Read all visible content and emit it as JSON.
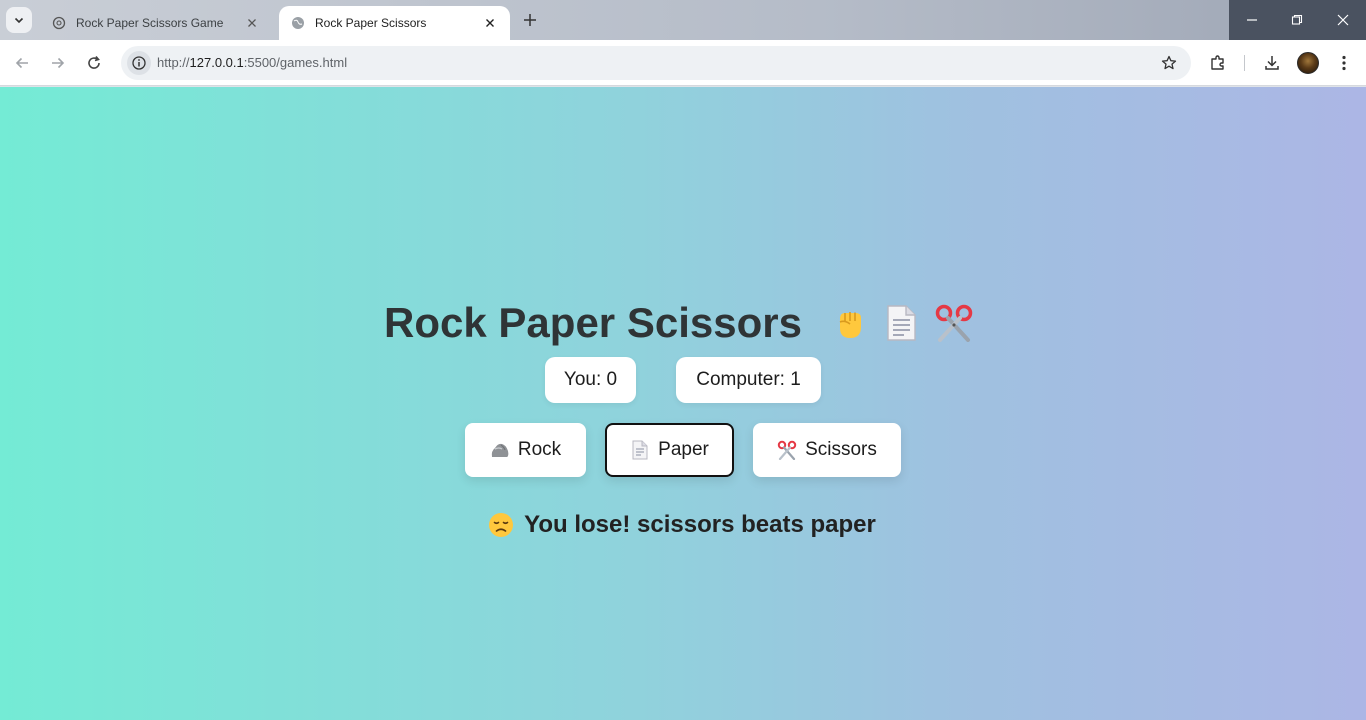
{
  "browser": {
    "tabs": [
      {
        "title": "Rock Paper Scissors Game",
        "active": false
      },
      {
        "title": "Rock Paper Scissors",
        "active": true
      }
    ],
    "url_prefix": "http://",
    "url_host": "127.0.0.1",
    "url_rest": ":5500/games.html"
  },
  "game": {
    "title": "Rock Paper Scissors",
    "title_icons": [
      "fist-icon",
      "page-icon",
      "scissors-icon"
    ],
    "score_you": "You: 0",
    "score_computer": "Computer: 1",
    "choices": [
      {
        "label": "Rock",
        "icon": "rock-icon",
        "selected": false
      },
      {
        "label": "Paper",
        "icon": "page-icon",
        "selected": true
      },
      {
        "label": "Scissors",
        "icon": "scissors-icon",
        "selected": false
      }
    ],
    "result": "You lose! scissors beats paper",
    "result_icon": "disappointed-face-icon"
  },
  "colors": {
    "gradient_start": "#74ebd5",
    "gradient_end": "#acb6e5"
  }
}
